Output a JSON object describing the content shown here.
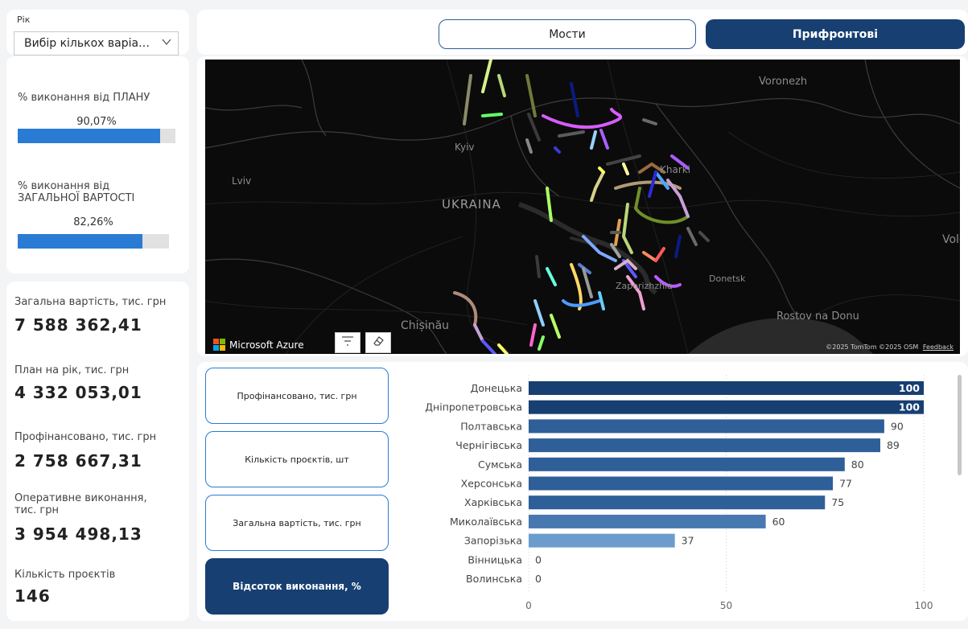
{
  "year_slicer": {
    "label": "Рік",
    "value": "Вибір кількох варіа…"
  },
  "progress": [
    {
      "label_lines": [
        "% виконання від ПЛАНУ"
      ],
      "value": "90,07%",
      "fraction": 0.9007
    },
    {
      "label_lines": [
        "% виконання від",
        "ЗАГАЛЬНОЇ ВАРТОСТІ"
      ],
      "value": "82,26%",
      "fraction": 0.8226
    }
  ],
  "kpis": [
    {
      "label_lines": [
        "Загальна вартість, тис. грн"
      ],
      "value": "7 588 362,41"
    },
    {
      "label_lines": [
        "План на рік, тис. грн"
      ],
      "value": "4 332 053,01"
    },
    {
      "label_lines": [
        "Профінансовано, тис. грн"
      ],
      "value": "2 758 667,31"
    },
    {
      "label_lines": [
        "Оперативне виконання,",
        "тис. грн"
      ],
      "value": "3 954 498,13"
    },
    {
      "label_lines": [
        "Кількість проєктів"
      ],
      "value": "146"
    }
  ],
  "tabs": {
    "bridges": "Мости",
    "frontline": "Прифронтові"
  },
  "map": {
    "labels": {
      "voronezh": "Voronezh",
      "kyiv": "Kyiv",
      "kharkiv": "Kharki",
      "lviv": "Lviv",
      "ukraina": "UKRAINA",
      "volg": "Volg",
      "zaporizhzhia": "Zaporizhzhia",
      "donetsk": "Donetsk",
      "rostov": "Rostov na Donu",
      "chisinau": "Chișinău"
    },
    "brand": "Microsoft Azure",
    "attribution": "©2025 TomTom  ©2025 OSM",
    "feedback": "Feedback",
    "logo_colors": [
      "#f25022",
      "#7fba00",
      "#00a4ef",
      "#ffb900"
    ],
    "filter_icon": "filter-icon",
    "eraser_icon": "eraser-icon"
  },
  "measure_buttons": [
    {
      "label": "Профінансовано, тис. грн",
      "active": false
    },
    {
      "label": "Кількість проєктів, шт",
      "active": false
    },
    {
      "label": "Загальна вартість, тис. грн",
      "active": false
    },
    {
      "label": "Відсоток виконання, %",
      "active": true
    }
  ],
  "chart_data": {
    "type": "bar",
    "orientation": "horizontal",
    "categories": [
      "Донецька",
      "Дніпропетровська",
      "Полтавська",
      "Чернігівська",
      "Сумська",
      "Херсонська",
      "Харківська",
      "Миколаївська",
      "Запорізька",
      "Вінницька",
      "Волинська"
    ],
    "values": [
      100,
      100,
      90,
      89,
      80,
      77,
      75,
      60,
      37,
      0,
      0
    ],
    "xlim": [
      0,
      100
    ],
    "xticks": [
      0,
      50,
      100
    ],
    "grid": true,
    "colors": {
      "dark": "#173f72",
      "light": "#7aa7d4"
    }
  }
}
